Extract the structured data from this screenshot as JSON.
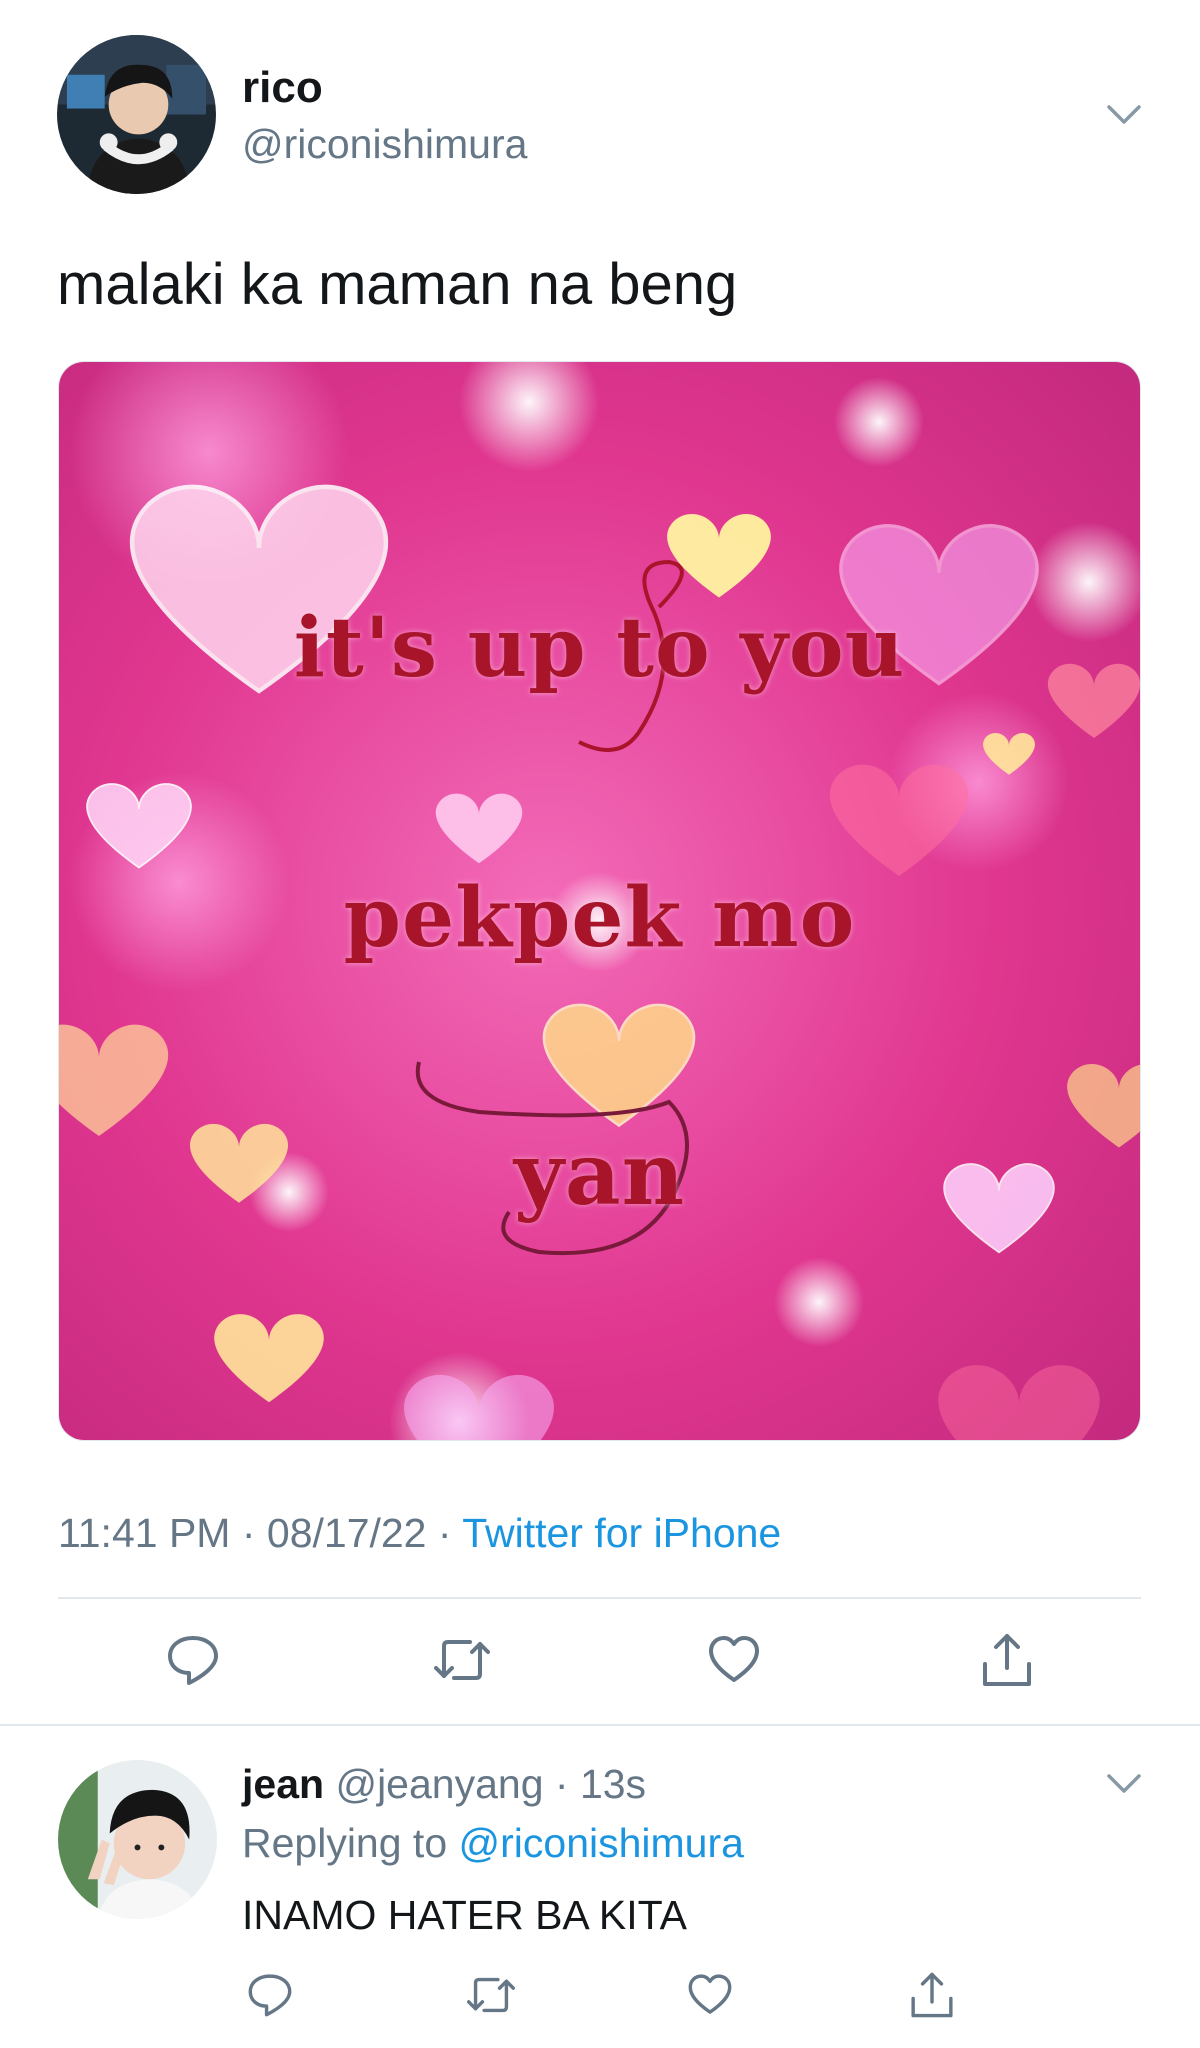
{
  "tweet": {
    "author": {
      "name": "rico",
      "handle": "@riconishimura"
    },
    "text": "malaki ka maman na beng",
    "image_text": {
      "line1": "it's up to you",
      "line2": "pekpek mo",
      "line3": "yan"
    },
    "meta": {
      "time": "11:41 PM",
      "separator": " · ",
      "date": "08/17/22",
      "source": "Twitter for iPhone"
    },
    "actions": [
      "reply-icon",
      "retweet-icon",
      "like-icon",
      "share-icon"
    ]
  },
  "reply": {
    "author": {
      "name": "jean",
      "handle": "@jeanyang"
    },
    "timestamp": "13s",
    "dot": " · ",
    "replying_prefix": "Replying to ",
    "replying_to": "@riconishimura",
    "text": "INAMO HATER BA KITA",
    "actions": [
      "reply-icon",
      "retweet-icon",
      "like-icon",
      "share-icon"
    ]
  },
  "colors": {
    "link": "#1b95e0",
    "muted": "#657786",
    "text": "#14171a",
    "divider": "#e1e8ed",
    "meme_text": "#a8142a",
    "meme_bg": "#e0368f"
  }
}
